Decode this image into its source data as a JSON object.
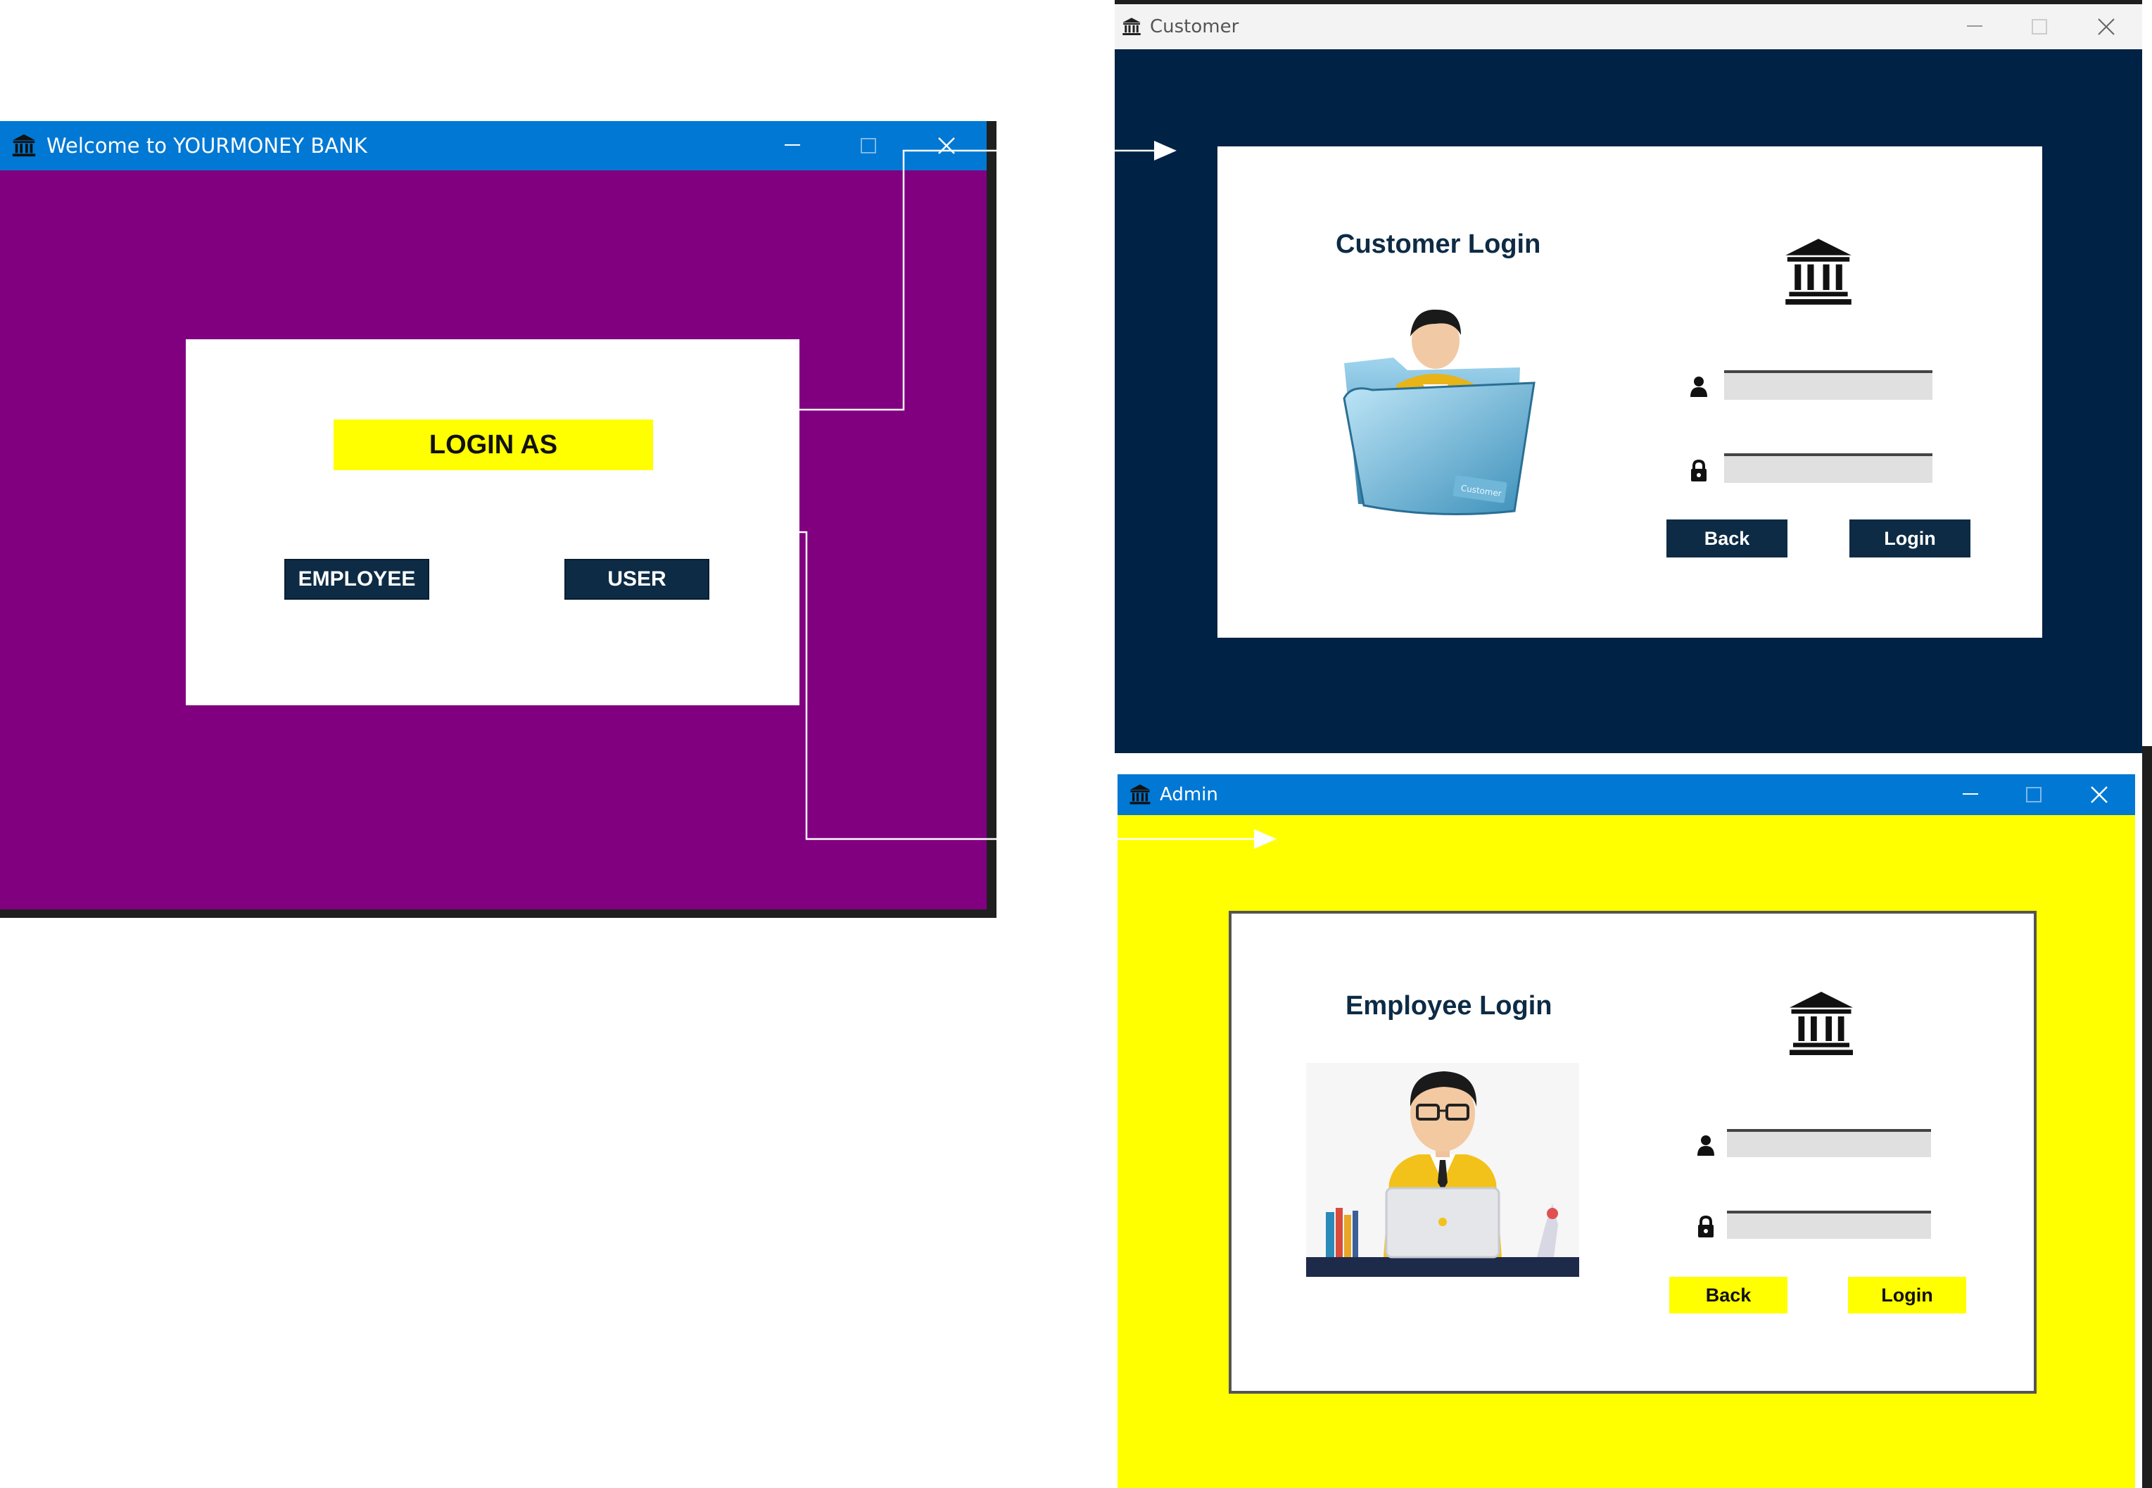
{
  "welcome_window": {
    "title": "Welcome to YOURMONEY BANK",
    "heading": "LOGIN AS",
    "employee_button": "EMPLOYEE",
    "user_button": "USER"
  },
  "customer_window": {
    "title": "Customer",
    "card_title": "Customer Login",
    "folder_label": "Customer",
    "back_button": "Back",
    "login_button": "Login"
  },
  "admin_window": {
    "title": "Admin",
    "card_title": "Employee Login",
    "back_button": "Back",
    "login_button": "Login"
  },
  "colors": {
    "welcome_bg": "#800080",
    "customer_bg": "#002244",
    "admin_bg": "#ffff00",
    "titlebar_blue": "#0078d4",
    "button_navy": "#0d2b45",
    "accent_yellow": "#ffff00"
  },
  "icons": [
    "bank-icon",
    "minimize-icon",
    "maximize-icon",
    "close-icon",
    "user-icon",
    "lock-icon",
    "arrow-icon"
  ]
}
